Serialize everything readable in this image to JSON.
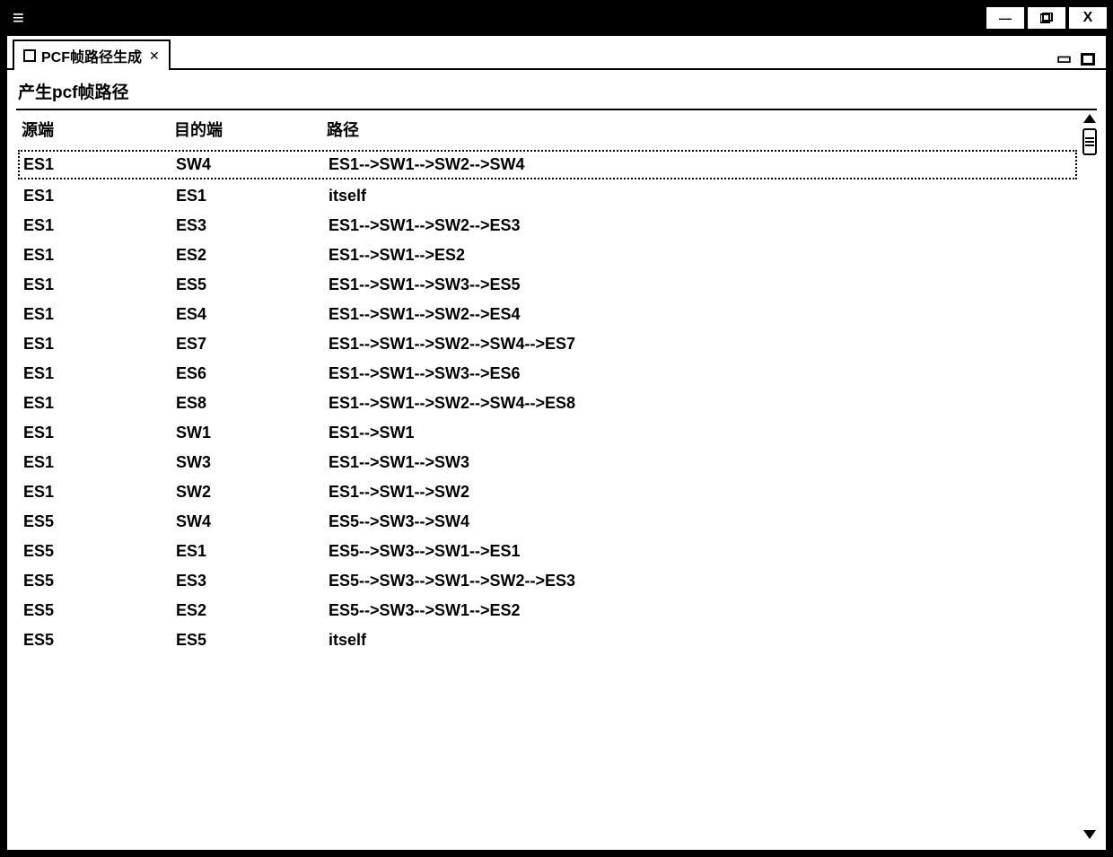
{
  "tab": {
    "label": "PCF帧路径生成",
    "close_glyph": "✕"
  },
  "panel": {
    "title": "产生pcf帧路径"
  },
  "table": {
    "headers": {
      "src": "源端",
      "dst": "目的端",
      "path": "路径"
    },
    "rows": [
      {
        "src": "ES1",
        "dst": "SW4",
        "path": "ES1-->SW1-->SW2-->SW4",
        "selected": true
      },
      {
        "src": "ES1",
        "dst": "ES1",
        "path": "itself"
      },
      {
        "src": "ES1",
        "dst": "ES3",
        "path": "ES1-->SW1-->SW2-->ES3"
      },
      {
        "src": "ES1",
        "dst": "ES2",
        "path": "ES1-->SW1-->ES2"
      },
      {
        "src": "ES1",
        "dst": "ES5",
        "path": "ES1-->SW1-->SW3-->ES5"
      },
      {
        "src": "ES1",
        "dst": "ES4",
        "path": "ES1-->SW1-->SW2-->ES4"
      },
      {
        "src": "ES1",
        "dst": "ES7",
        "path": "ES1-->SW1-->SW2-->SW4-->ES7"
      },
      {
        "src": "ES1",
        "dst": "ES6",
        "path": "ES1-->SW1-->SW3-->ES6"
      },
      {
        "src": "ES1",
        "dst": "ES8",
        "path": "ES1-->SW1-->SW2-->SW4-->ES8"
      },
      {
        "src": "ES1",
        "dst": "SW1",
        "path": "ES1-->SW1"
      },
      {
        "src": "ES1",
        "dst": "SW3",
        "path": "ES1-->SW1-->SW3"
      },
      {
        "src": "ES1",
        "dst": "SW2",
        "path": "ES1-->SW1-->SW2"
      },
      {
        "src": "ES5",
        "dst": "SW4",
        "path": "ES5-->SW3-->SW4"
      },
      {
        "src": "ES5",
        "dst": "ES1",
        "path": "ES5-->SW3-->SW1-->ES1"
      },
      {
        "src": "ES5",
        "dst": "ES3",
        "path": "ES5-->SW3-->SW1-->SW2-->ES3"
      },
      {
        "src": "ES5",
        "dst": "ES2",
        "path": "ES5-->SW3-->SW1-->ES2"
      },
      {
        "src": "ES5",
        "dst": "ES5",
        "path": "itself"
      }
    ]
  },
  "window_controls": {
    "minimize": "—",
    "maximize": "▢",
    "close": "X"
  },
  "hamburger": "≡"
}
